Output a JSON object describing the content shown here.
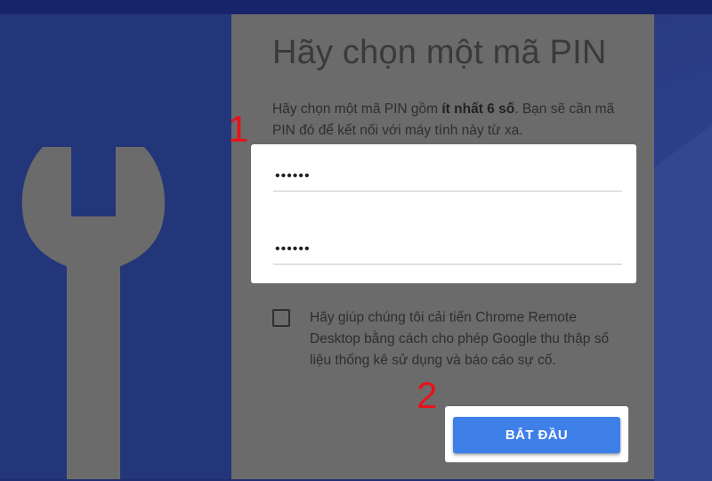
{
  "dialog": {
    "title": "Hãy chọn một mã PIN",
    "description_before": "Hãy chọn một mã PIN gồm ",
    "description_bold": "ít nhất 6 số",
    "description_after": ". Bạn sẽ cần mã PIN đó để kết nối với máy tính này từ xa.",
    "pin_value": "••••••",
    "pin_confirm_value": "••••••",
    "consent_checked": false,
    "consent_text": "Hãy giúp chúng tôi cải tiến Chrome Remote Desktop bằng cách cho phép Google thu thập số liệu thống kê sử dụng và báo cáo sự cố.",
    "start_label": "BẮT ĐẦU"
  },
  "annotations": {
    "step1": "1",
    "step2": "2"
  },
  "colors": {
    "background": "#1f2f72",
    "panel": "#6b6b6b",
    "wrench": "#6b6b6b",
    "annotation": "#e8121b",
    "button": "#3f7fe8"
  },
  "icons": {
    "wrench": "wrench-icon"
  }
}
